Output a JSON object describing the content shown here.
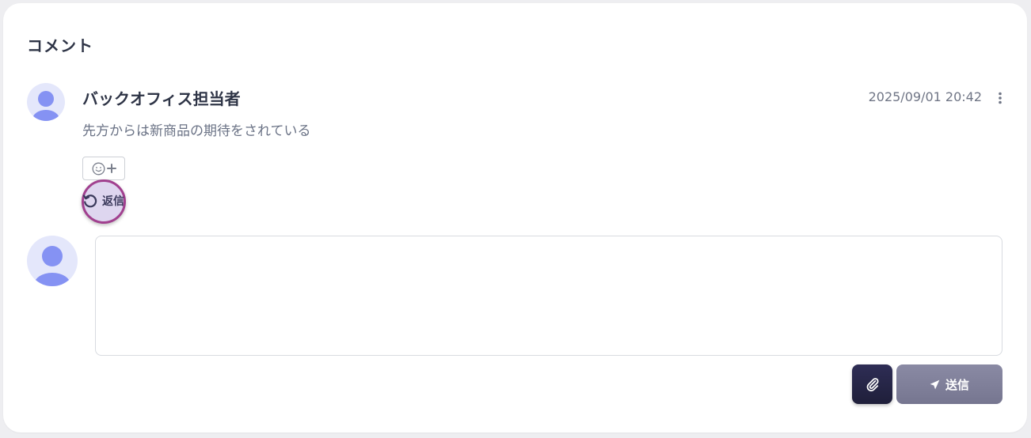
{
  "section": {
    "title": "コメント"
  },
  "comment": {
    "author": "バックオフィス担当者",
    "timestamp": "2025/09/01 20:42",
    "body": "先方からは新商品の期待をされている",
    "more_icon": "vertical-ellipsis-icon",
    "reaction_icon": "add-emoji-icon",
    "reply_label": "返信",
    "reply_icon": "reply-arrow-icon"
  },
  "composer": {
    "value": "",
    "placeholder": "",
    "attach_icon": "paperclip-icon",
    "send_icon": "paper-plane-icon",
    "send_label": "送信"
  },
  "colors": {
    "accent_dark": "#2e2d55",
    "send_disabled": "#80809a",
    "avatar_fill": "#8592f3",
    "highlight_ring": "#a1408f"
  }
}
